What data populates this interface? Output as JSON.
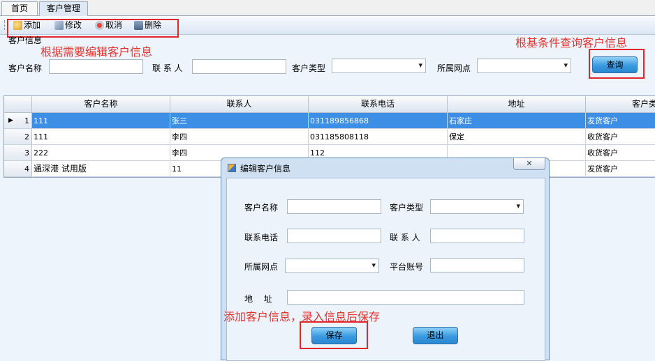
{
  "tabs": [
    {
      "label": "首页"
    },
    {
      "label": "客户管理"
    }
  ],
  "toolbar": {
    "add": "添加",
    "edit": "修改",
    "cancel": "取消",
    "delete": "删除"
  },
  "search": {
    "group_title": "客户信息",
    "name_label": "客户名称",
    "contact_label": "联 系 人",
    "type_label": "客户类型",
    "outlet_label": "所属网点",
    "query_button": "查询"
  },
  "annotations": {
    "edit_hint": "根据需要编辑客户信息",
    "query_hint": "根基条件查询客户信息",
    "save_hint": "添加客户信息，录入信息后保存"
  },
  "table": {
    "columns": [
      "客户名称",
      "联系人",
      "联系电话",
      "地址",
      "客户类"
    ],
    "rows": [
      {
        "num": "1",
        "name": "111",
        "contact": "张三",
        "phone": "031189856868",
        "address": "石家庄",
        "type": "发货客户"
      },
      {
        "num": "2",
        "name": "111",
        "contact": "李四",
        "phone": "031185808118",
        "address": "保定",
        "type": "收货客户"
      },
      {
        "num": "3",
        "name": "222",
        "contact": "李四",
        "phone": "112",
        "address": "",
        "type": "收货客户"
      },
      {
        "num": "4",
        "name": "通深港 试用版",
        "contact": "11",
        "phone": "",
        "address": "",
        "type": "发货客户"
      }
    ]
  },
  "dialog": {
    "title": "编辑客户信息",
    "name_label": "客户名称",
    "type_label": "客户类型",
    "phone_label": "联系电话",
    "contact_label": "联 系 人",
    "outlet_label": "所属网点",
    "account_label": "平台账号",
    "address_label": "地　 址",
    "save_button": "保存",
    "exit_button": "退出"
  },
  "colors": {
    "annotation": "#e8322d",
    "selected_row": "#3d8fe6",
    "button_blue": "#3a9ae0"
  }
}
